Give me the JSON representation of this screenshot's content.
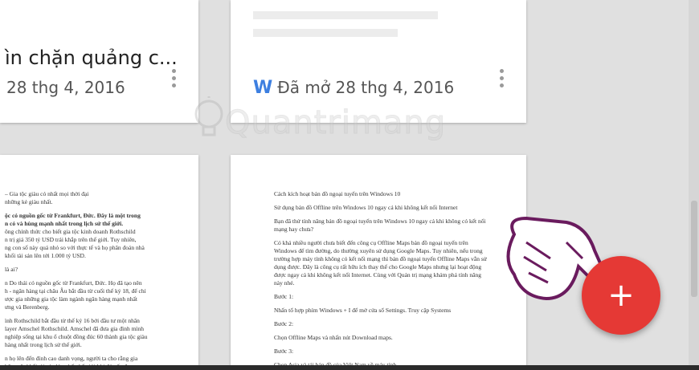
{
  "cards": {
    "top_left": {
      "title": "ìn chặn quảng c...",
      "date": "28 thg 4, 2016"
    },
    "top_right": {
      "icon": "W",
      "opened_label": "Đã mở 28 thg 4, 2016"
    }
  },
  "doc_left": {
    "lines": [
      "– Gia tộc giàu có nhất mọi thời đại",
      "những kẻ giàu nhất.",
      "ộc có nguồn gốc từ Frankfurt, Đức. Đây là một trong",
      "n có và hùng mạnh nhất trong lịch sử thế giới.",
      "ông chính thức cho biết gia tộc kinh doanh Rothschild",
      "n trị giá 350 tỷ USD trải khắp trên thế giới. Tuy nhiên,",
      "ng con số này quá nhỏ so với thực tế và họ phân đoán nhà",
      "khối tài sản lên tới 1.000 tỷ USD.",
      "là ai?",
      "n Do thái có nguồn gốc từ Frankfurt, Đức. Họ đã tạo nên",
      "h - ngân hàng tại châu Âu bắt đầu từ cuối thế kỷ 18, để chỉ",
      "ược gia những gia tộc làm ngành ngân hàng mạnh nhất",
      "ưng và Berenberg.",
      "ình Rothschild bắt đầu từ thế kỷ 16 bởi đầu tư một nhân",
      "layer Amschel Rothschild. Amschel đã đưa gia đình mình",
      "nghiệp sống tại khu ổ chuột đồng đúc 60 thành gia tộc giàu",
      "hàng nhất trong lịch sử thế giới.",
      "n họ lên đến đỉnh cao danh vọng, người ta cho rằng gia",
      "hữu một khối tài sản lớn nhất thế giới khi đó nếu đem"
    ]
  },
  "doc_right": {
    "paragraphs": [
      "Cách kích hoạt bản đồ ngoại tuyến trên Windows 10",
      "Sử dụng bản đồ Offline trên Windows 10 ngay cả khi không kết nối Internet",
      "Bạn đã thử tính năng bản đồ ngoại tuyến trên Windows 10 ngay cả khi không có kết nối mạng hay chưa?",
      "Có khá nhiều người chưa biết đến công cụ Offline Maps bản đồ ngoại tuyến trên Windows để tìm đường, do thường xuyên sử dụng Google Maps. Tuy nhiên, nếu trong trường hợp máy tính không có kết nối mạng thì bản đồ ngoại tuyến Offline Maps vẫn sử dụng được. Đây là công cụ rất hữu ích thay thế cho Google Maps nhưng lại hoạt động được ngay cả khi không kết nối Internet. Cùng với Quản trị mạng khám phá tính năng này nhé.",
      "Bước 1:",
      "Nhấn tổ hợp phím Windows + I để mở cửa sổ Settings. Truy cập Systems",
      "Bước 2:",
      "Chọn Offline Maps và nhấn nút Download maps.",
      "Bước 3:",
      "Chọn Asia và tải bản đồ của Việt Nam về máy tính."
    ]
  },
  "fab": {
    "label": "+"
  },
  "watermark": {
    "text": "Quantrimang"
  },
  "colors": {
    "fab": "#e53935",
    "word_icon": "#3d7fe0",
    "background": "#e0e0e0"
  }
}
